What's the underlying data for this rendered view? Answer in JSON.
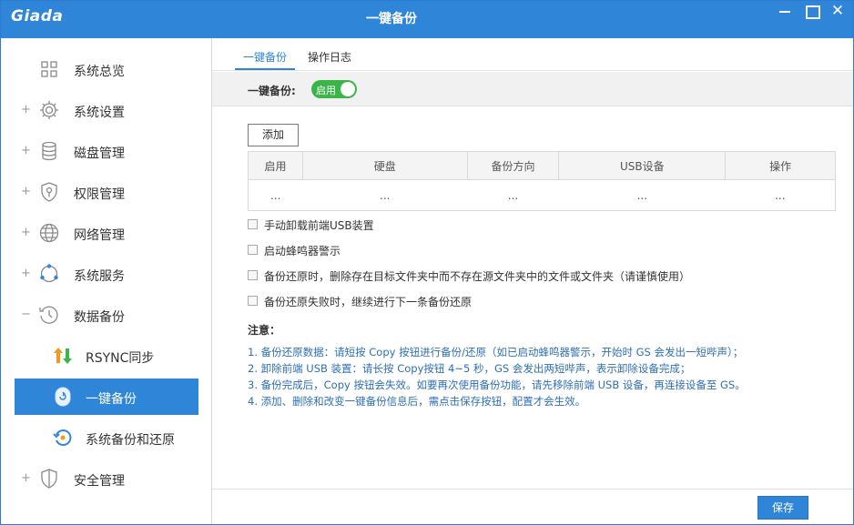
{
  "app": {
    "logo": "Giada",
    "title": "一键备份",
    "close_glyph": "✕"
  },
  "sidebar": {
    "items": [
      {
        "label": "系统总览",
        "icon": "dashboard-grid-icon",
        "expander": ""
      },
      {
        "label": "系统设置",
        "icon": "gear-icon",
        "expander": "+"
      },
      {
        "label": "磁盘管理",
        "icon": "database-icon",
        "expander": "+"
      },
      {
        "label": "权限管理",
        "icon": "shield-key-icon",
        "expander": "+"
      },
      {
        "label": "网络管理",
        "icon": "globe-icon",
        "expander": "+"
      },
      {
        "label": "系统服务",
        "icon": "network-service-icon",
        "expander": "+"
      },
      {
        "label": "数据备份",
        "icon": "clock-history-icon",
        "expander": "−"
      },
      {
        "label": "RSYNC同步",
        "icon": "sync-arrows-icon"
      },
      {
        "label": "一键备份",
        "icon": "one-key-backup-icon"
      },
      {
        "label": "系统备份和还原",
        "icon": "restore-icon"
      },
      {
        "label": "安全管理",
        "icon": "shield-icon",
        "expander": "+"
      }
    ],
    "active_index": 8
  },
  "tabs": [
    {
      "label": "一键备份"
    },
    {
      "label": "操作日志"
    }
  ],
  "enable": {
    "label": "一键备份:",
    "toggle_label": "启用",
    "state": "on"
  },
  "add_button": "添加",
  "table": {
    "headers": [
      "启用",
      "硬盘",
      "备份方向",
      "USB设备",
      "操作"
    ],
    "rows": [
      [
        "...",
        "...",
        "...",
        "...",
        "..."
      ]
    ]
  },
  "options": [
    {
      "label": "手动卸载前端USB装置",
      "checked": false
    },
    {
      "label": "启动蜂鸣器警示",
      "checked": false
    },
    {
      "label": "备份还原时，删除存在目标文件夹中而不存在源文件夹中的文件或文件夹（请谨慎使用）",
      "checked": false
    },
    {
      "label": "备份还原失败时，继续进行下一条备份还原",
      "checked": false
    }
  ],
  "notes": {
    "title": "注意：",
    "lines": [
      "1. 备份还原数据：请短按 Copy 按钮进行备份/还原（如已启动蜂鸣器警示，开始时 GS 会发出一短哔声）；",
      "2. 卸除前端 USB 装置：请长按 Copy按钮 4~5 秒，GS 会发出两短哔声，表示卸除设备完成；",
      "3. 备份完成后，Copy 按钮会失效。如要再次使用备份功能，请先移除前端 USB 设备，再连接设备至 GS。",
      "4. 添加、删除和改变一键备份信息后，需点击保存按钮，配置才会生效。"
    ]
  },
  "save_button": "保存",
  "colors": {
    "accent": "#2f86d8",
    "toggle_on": "#3bb54a",
    "note_text": "#2f6fb6"
  }
}
